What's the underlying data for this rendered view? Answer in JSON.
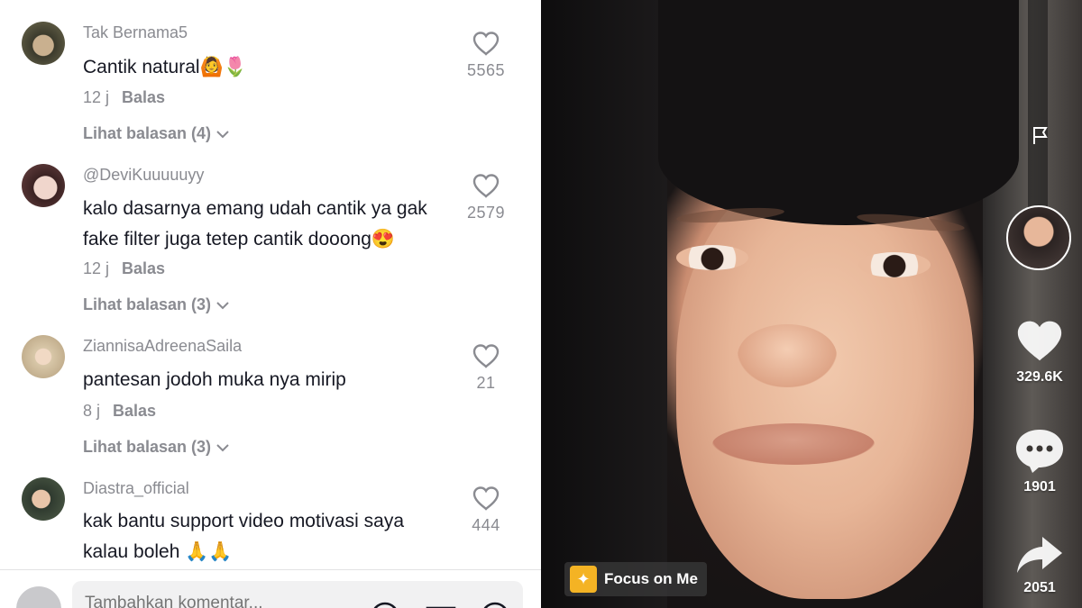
{
  "comments": [
    {
      "user": "Tak Bernama5",
      "text": "Cantik natural",
      "emojis": "🙆🌷",
      "time": "12 j",
      "reply_label": "Balas",
      "view_replies": "Lihat balasan (4)",
      "likes": "5565"
    },
    {
      "user": "@DeviKuuuuuyy",
      "text_line1": "kalo dasarnya emang udah cantik ya gak",
      "text_line2": "fake filter juga tetep cantik dooong",
      "emojis": "😍",
      "time": "12 j",
      "reply_label": "Balas",
      "view_replies": "Lihat balasan (3)",
      "likes": "2579"
    },
    {
      "user": "ZiannisaAdreenaSaila",
      "text": "pantesan jodoh muka nya mirip",
      "time": "8 j",
      "reply_label": "Balas",
      "view_replies": "Lihat balasan (3)",
      "likes": "21"
    },
    {
      "user": "Diastra_official",
      "text_line1": "kak bantu support video motivasi saya",
      "text_line2": "kalau boleh",
      "emojis": "🙏🙏",
      "likes": "444"
    }
  ],
  "comment_input": {
    "placeholder": "Tambahkan komentar..."
  },
  "video": {
    "likes": "329.6K",
    "comments": "1901",
    "shares": "2051",
    "effect_label": "Focus on Me"
  },
  "colors": {
    "secondary_text": "#8a8b91",
    "primary_text": "#161823",
    "effect_badge": "#f4b324"
  }
}
